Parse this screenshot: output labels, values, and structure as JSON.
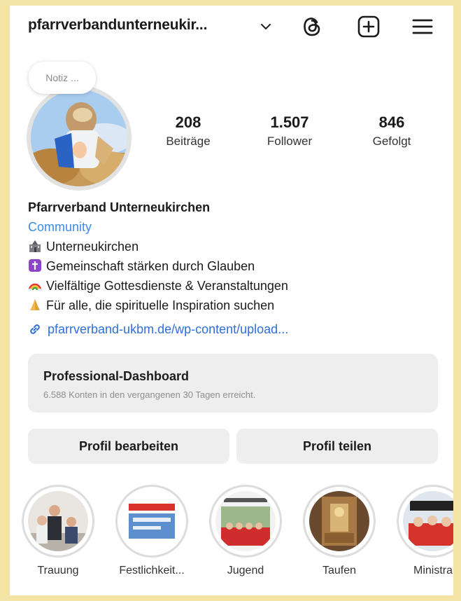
{
  "header": {
    "username": "pfarrverbandunterneukir...",
    "icons": [
      "chevron-down-icon",
      "threads-icon",
      "add-post-icon",
      "menu-icon"
    ]
  },
  "profile": {
    "note": "Notiz ...",
    "stats": [
      {
        "value": "208",
        "label": "Beiträge"
      },
      {
        "value": "1.507",
        "label": "Follower"
      },
      {
        "value": "846",
        "label": "Gefolgt"
      }
    ]
  },
  "bio": {
    "name": "Pfarrverband Unterneukirchen",
    "category": "Community",
    "lines": [
      {
        "emoji": "church-icon",
        "text": "Unterneukirchen"
      },
      {
        "emoji": "place-of-worship-icon",
        "text": "Gemeinschaft stärken durch Glauben"
      },
      {
        "emoji": "rainbow-icon",
        "text": "Vielfältige Gottesdienste & Veranstaltungen"
      },
      {
        "emoji": "praying-hands-icon",
        "text": "Für alle, die spirituelle Inspiration suchen"
      }
    ],
    "link": "pfarrverband-ukbm.de/wp-content/upload..."
  },
  "dashboard": {
    "title": "Professional-Dashboard",
    "subtitle": "6.588 Konten in den vergangenen 30 Tagen erreicht."
  },
  "buttons": {
    "edit": "Profil bearbeiten",
    "share": "Profil teilen"
  },
  "highlights": [
    {
      "label": "Trauung"
    },
    {
      "label": "Festlichkeit..."
    },
    {
      "label": "Jugend"
    },
    {
      "label": "Taufen"
    },
    {
      "label": "Ministra"
    }
  ],
  "colors": {
    "background": "#f3e3a4",
    "link": "#2f6fd8",
    "category": "#3b8ce6",
    "button": "#eeeeef"
  }
}
